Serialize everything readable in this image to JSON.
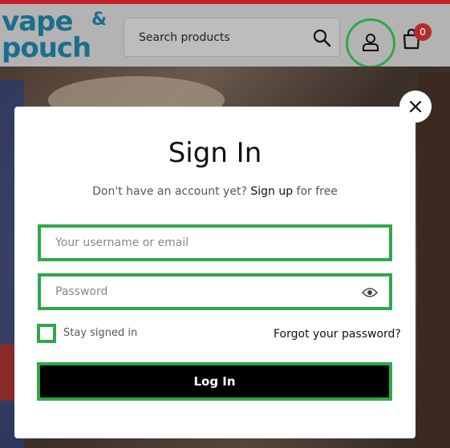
{
  "header": {
    "logo_line1": "vape",
    "logo_amp": "&",
    "logo_line2": "pouch",
    "search_placeholder": "Search products",
    "cart_count": "0",
    "icons": [
      "search-icon",
      "user-icon",
      "cart-icon"
    ]
  },
  "modal": {
    "title": "Sign In",
    "signup_prefix": "Don't have an account yet?",
    "signup_link": "Sign up",
    "signup_suffix": "for free",
    "username_placeholder": "Your username or email",
    "password_placeholder": "Password",
    "stay_signed_in": "Stay signed in",
    "forgot_password": "Forgot your password?",
    "login_label": "Log In",
    "close_icon": "close-icon"
  },
  "colors": {
    "brand_red": "#c41f24",
    "logo_blue": "#1b6e8c",
    "highlight_green": "#2ea84a",
    "badge_red": "#b52a2a"
  }
}
